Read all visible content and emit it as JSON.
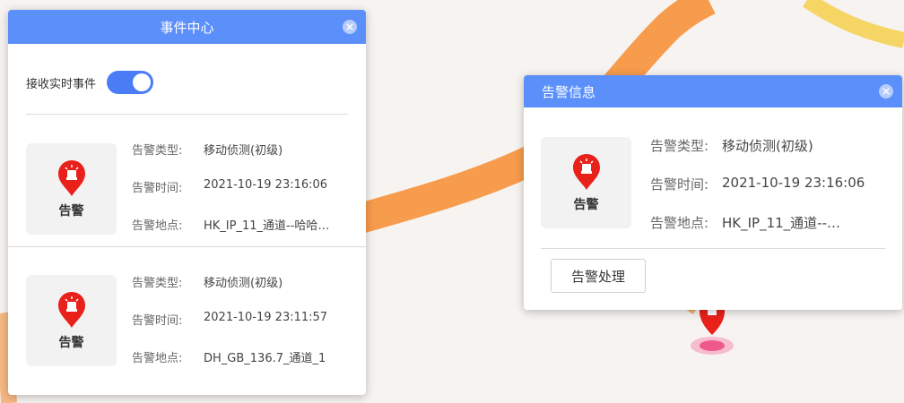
{
  "colors": {
    "header_blue": "#5b8ff9",
    "toggle_blue": "#4a7cf5",
    "alarm_red": "#e8211a",
    "route_orange": "#f7913a",
    "route_yellow": "#f5cf4a"
  },
  "event_center": {
    "title": "事件中心",
    "close_icon": "close-icon",
    "realtime_label": "接收实时事件",
    "realtime_enabled": true,
    "events": [
      {
        "card_label": "告警",
        "icon": "alarm-pin-icon",
        "type_key": "告警类型:",
        "type_val": "移动侦测(初级)",
        "time_key": "告警时间:",
        "time_val": "2021-10-19 23:16:06",
        "location_key": "告警地点:",
        "location_val": "HK_IP_11_通道--哈哈…"
      },
      {
        "card_label": "告警",
        "icon": "alarm-pin-icon",
        "type_key": "告警类型:",
        "type_val": "移动侦测(初级)",
        "time_key": "告警时间:",
        "time_val": "2021-10-19 23:11:57",
        "location_key": "告警地点:",
        "location_val": "DH_GB_136.7_通道_1"
      }
    ]
  },
  "alarm_info": {
    "title": "告警信息",
    "close_icon": "close-icon",
    "card_label": "告警",
    "icon": "alarm-pin-icon",
    "type_key": "告警类型:",
    "type_val": "移动侦测(初级)",
    "time_key": "告警时间:",
    "time_val": "2021-10-19 23:16:06",
    "location_key": "告警地点:",
    "location_val": "HK_IP_11_通道--…",
    "handle_button": "告警处理"
  }
}
